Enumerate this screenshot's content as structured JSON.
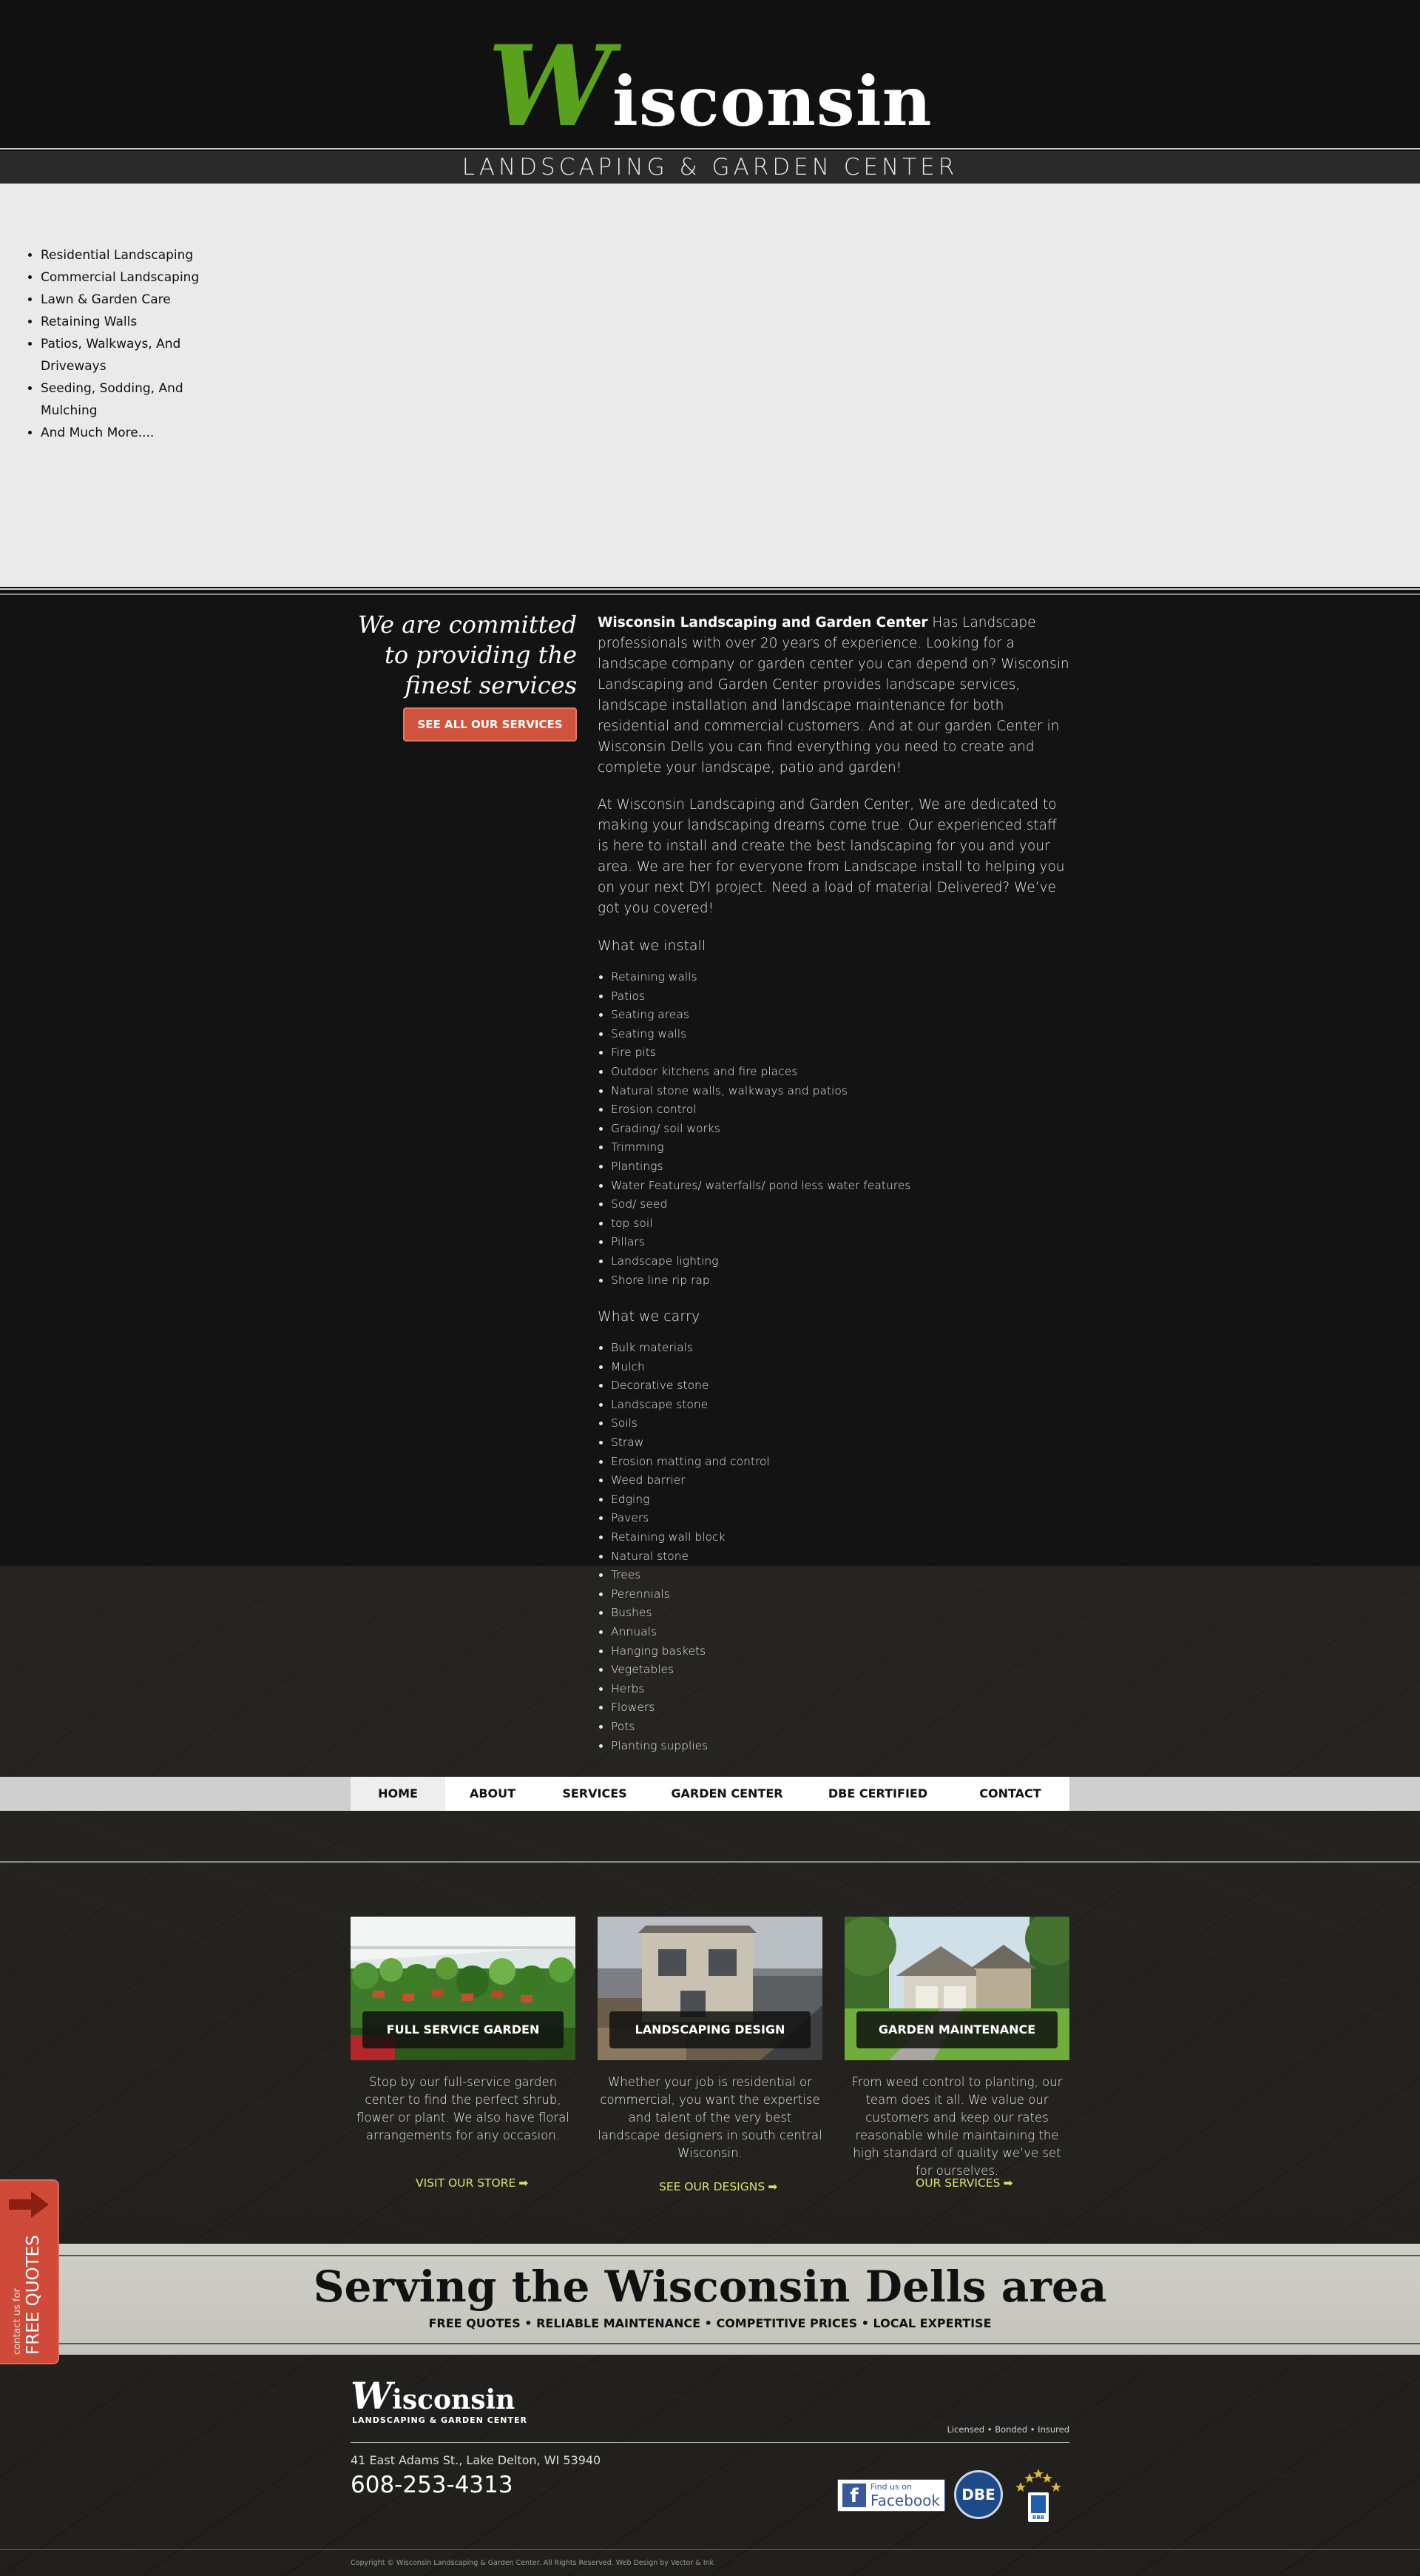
{
  "header": {
    "logo_first_letter": "W",
    "logo_rest": "isconsin",
    "tagline": "LANDSCAPING & GARDEN CENTER"
  },
  "services_panel": {
    "items": [
      "Residential Landscaping",
      "Commercial Landscaping",
      "Lawn & Garden Care",
      "Retaining Walls",
      "Patios, Walkways, And Driveways",
      "Seeding, Sodding, And Mulching",
      "And Much More...."
    ]
  },
  "intro": {
    "heading": "We are committed to providing the finest services",
    "button_label": "SEE ALL OUR SERVICES",
    "para1_bold": "Wisconsin Landscaping and Garden Center",
    "para1_text": "  Has Landscape professionals with over 20 years of experience.  Looking for a landscape company or garden center you can depend on? Wisconsin Landscaping and Garden Center provides landscape services, landscape installation and landscape maintenance for both  residential and commercial customers.  And at our garden Center in Wisconsin Dells you can find everything you need to create and complete your landscape, patio and garden!",
    "para2": "At Wisconsin Landscaping and Garden Center, We are dedicated to making your landscaping dreams come true.  Our experienced staff is here to install and create the best landscaping for you and your area.  We are her for everyone from Landscape install to helping you on your next DYI project.  Need a load of material Delivered? We’ve got you covered!",
    "install_heading": "What we install",
    "install_items": [
      "Retaining walls",
      "Patios",
      "Seating areas",
      "Seating walls",
      "Fire pits",
      "Outdoor kitchens and fire places",
      "Natural stone walls, walkways and patios",
      "Erosion control",
      "Grading/ soil works",
      "Trimming",
      "Plantings",
      "Water Features/ waterfalls/ pond less water features",
      "Sod/ seed",
      "top soil",
      "Pillars",
      "Landscape lighting",
      "Shore line rip rap"
    ],
    "carry_heading": "What we carry",
    "carry_items": [
      "Bulk materials",
      "Mulch",
      "Decorative stone",
      "Landscape stone",
      "Soils",
      "Straw",
      "Erosion matting and control",
      "Weed barrier",
      "Edging",
      "Pavers",
      "Retaining wall block",
      "Natural stone",
      "Trees",
      "Perennials",
      "Bushes",
      "Annuals",
      "Hanging baskets",
      "Vegetables",
      "Herbs",
      "Flowers",
      "Pots",
      "Planting supplies"
    ]
  },
  "nav": {
    "items": [
      {
        "label": "HOME"
      },
      {
        "label": "ABOUT"
      },
      {
        "label": "SERVICES"
      },
      {
        "label": "GARDEN CENTER"
      },
      {
        "label": "DBE CERTIFIED"
      },
      {
        "label": "CONTACT"
      }
    ]
  },
  "cards": [
    {
      "title": "FULL SERVICE GARDEN CENTER",
      "text": "Stop by our full-service garden center to find the perfect shrub, flower or plant. We also have floral arrangements for any occasion.",
      "link": "VISIT OUR STORE"
    },
    {
      "title": "LANDSCAPING DESIGN",
      "text": "Whether your job is residential or commercial, you want the expertise and talent of the very best landscape designers in south central Wisconsin.",
      "link": "SEE OUR DESIGNS"
    },
    {
      "title": "GARDEN MAINTENANCE",
      "text": "From weed control to planting, our team does it all. We value our customers and keep our rates reasonable while maintaining the high standard of quality we’ve set for ourselves.",
      "link": "OUR SERVICES"
    }
  ],
  "serving": {
    "title": "Serving the Wisconsin Dells area",
    "subtitle": "FREE QUOTES • RELIABLE MAINTENANCE • COMPETITIVE PRICES • LOCAL EXPERTISE"
  },
  "footer": {
    "logo_first_letter": "W",
    "logo_rest": "isconsin",
    "tagline": "LANDSCAPING & GARDEN CENTER",
    "credentials": "Licensed • Bonded • Insured",
    "address": "41 East Adams St., Lake Delton, WI 53940",
    "phone": "608-253-4313",
    "facebook_line1": "Find us on",
    "facebook_line2": "Facebook",
    "dbe_label": "DBE",
    "copyright": "Copyright © Wisconsin Landscaping & Garden Center. All Rights Reserved. Web Design by Vector & Ink"
  },
  "quote_tab": {
    "small": "contact us for",
    "big": "FREE QUOTES"
  },
  "colors": {
    "brand_green": "#5aa21e",
    "accent_red": "#d0533d",
    "link_yellow": "#d9e06a",
    "background_dark": "#131313"
  }
}
